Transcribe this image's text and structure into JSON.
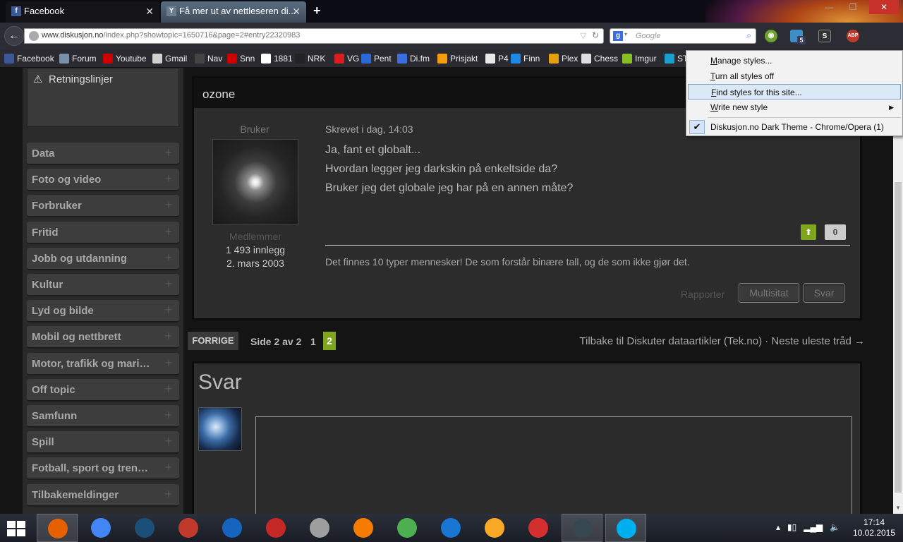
{
  "tabs": [
    {
      "title": "Facebook",
      "favicon": "f"
    },
    {
      "title": "Få mer ut av nettleseren di...",
      "favicon": "Y"
    }
  ],
  "window": {
    "minimize": "—",
    "maximize": "❐",
    "close": "✕"
  },
  "address": {
    "host": "www.diskusjon.no",
    "path": "/index.php?showtopic=1650716&page=2#entry22320983"
  },
  "search": {
    "placeholder": "Google",
    "engine": "g"
  },
  "toolbar_icons": {
    "badge": "5"
  },
  "bookmarks": [
    {
      "label": "Facebook",
      "color": "#3b5998"
    },
    {
      "label": "Forum",
      "color": "#7a8fa8"
    },
    {
      "label": "Youtube",
      "color": "#cc0000"
    },
    {
      "label": "Gmail",
      "color": "#d0d0d0"
    },
    {
      "label": "Nav",
      "color": "#444444"
    },
    {
      "label": "Snn",
      "color": "#cc0000"
    },
    {
      "label": "1881",
      "color": "#ffffff"
    },
    {
      "label": "NRK",
      "color": "#222222"
    },
    {
      "label": "VG",
      "color": "#d81e1e"
    },
    {
      "label": "Pent",
      "color": "#2a6ad6"
    },
    {
      "label": "Di.fm",
      "color": "#3b6fe0"
    },
    {
      "label": "Prisjakt",
      "color": "#f39c12"
    },
    {
      "label": "P4",
      "color": "#e8e8e8"
    },
    {
      "label": "Finn",
      "color": "#1e88e5"
    },
    {
      "label": "Plex",
      "color": "#e5a00d"
    },
    {
      "label": "Chess",
      "color": "#dddddd"
    },
    {
      "label": "Imgur",
      "color": "#85bf25"
    },
    {
      "label": "ST",
      "color": "#1a9fcf"
    }
  ],
  "sidebar": {
    "guidelines": "Retningslinjer",
    "categories": [
      "Data",
      "Foto og video",
      "Forbruker",
      "Fritid",
      "Jobb og utdanning",
      "Kultur",
      "Lyd og bilde",
      "Mobil og nettbrett",
      "Motor, trafikk og mari…",
      "Off topic",
      "Samfunn",
      "Spill",
      "Fotball, sport og tren…",
      "Tilbakemeldinger"
    ],
    "plus": "+"
  },
  "post": {
    "username": "ozone",
    "role": "Bruker",
    "group": "Medlemmer",
    "post_count": "1 493 innlegg",
    "joined": "2. mars 2003",
    "date": "Skrevet i dag, 14:03",
    "lines": [
      "Ja, fant et globalt...",
      "Hvordan legger jeg darkskin på enkeltside da?",
      "Bruker jeg det globale jeg har på en annen måte?"
    ],
    "vote_up": "⬆",
    "votes": "0",
    "signature": "Det finnes 10 typer mennesker! De som forstår binære tall, og de som ikke gjør det.",
    "report": "Rapporter",
    "multiquote": "Multisitat",
    "reply": "Svar"
  },
  "pager": {
    "prev": "FORRIGE",
    "page_of": "Side 2 av 2",
    "page1": "1",
    "page2": "2",
    "back_link": "Tilbake til Diskuter dataartikler (Tek.no) · Neste uleste tråd →"
  },
  "reply_box": {
    "title": "Svar"
  },
  "stylish_menu": {
    "items": [
      {
        "prefix": "M",
        "rest": "anage styles..."
      },
      {
        "prefix": "T",
        "rest": "urn all styles off"
      },
      {
        "prefix": "F",
        "rest": "ind styles for this site..."
      },
      {
        "prefix": "W",
        "rest": "rite new style"
      }
    ],
    "style_name": "Diskusjon.no Dark Theme - Chrome/Opera (1)",
    "check": "✔",
    "submenu_arrow": "▶"
  },
  "taskbar": {
    "apps": [
      {
        "name": "firefox",
        "color": "#e66000"
      },
      {
        "name": "chrome",
        "color": "#4285f4"
      },
      {
        "name": "steam",
        "color": "#1b4f78"
      },
      {
        "name": "ccleaner",
        "color": "#c0392b"
      },
      {
        "name": "malwarebytes",
        "color": "#1565c0"
      },
      {
        "name": "blocked",
        "color": "#c62828"
      },
      {
        "name": "wall",
        "color": "#9e9e9e"
      },
      {
        "name": "orange-app",
        "color": "#f57c00"
      },
      {
        "name": "utorrent",
        "color": "#4caf50"
      },
      {
        "name": "phone",
        "color": "#1976d2"
      },
      {
        "name": "winamp",
        "color": "#f9a825"
      },
      {
        "name": "popcorn",
        "color": "#d32f2f"
      },
      {
        "name": "mouse",
        "color": "#37474f"
      },
      {
        "name": "skype",
        "color": "#00aff0"
      }
    ],
    "clock_time": "17:14",
    "clock_date": "10.02.2015"
  }
}
